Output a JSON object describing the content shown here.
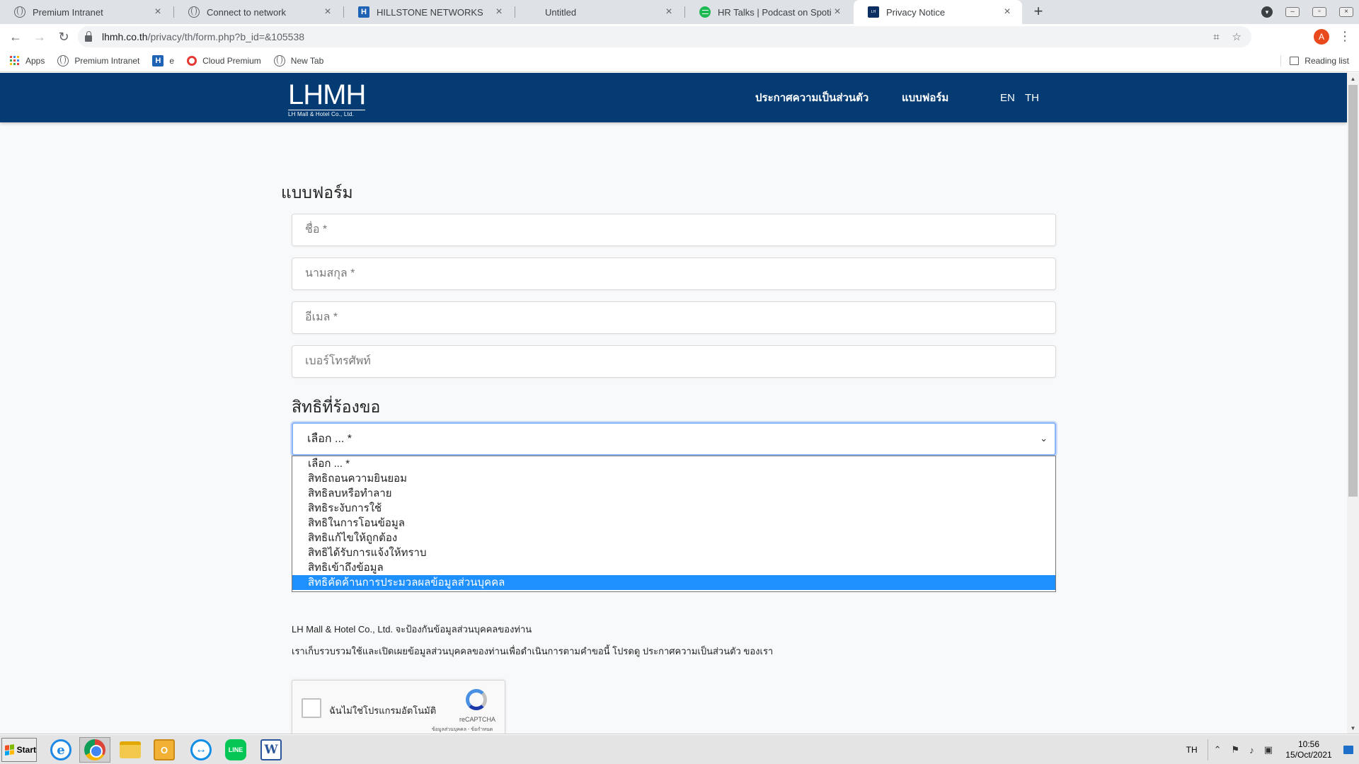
{
  "browser": {
    "tabs": [
      {
        "title": "Premium Intranet",
        "favicon": "globe-icon"
      },
      {
        "title": "Connect to network",
        "favicon": "globe-icon"
      },
      {
        "title": "HILLSTONE NETWORKS",
        "favicon": "hillstone-icon"
      },
      {
        "title": "Untitled",
        "favicon": "none"
      },
      {
        "title": "HR Talks | Podcast on Spotify",
        "favicon": "spotify-icon"
      },
      {
        "title": "Privacy Notice",
        "favicon": "lhmh-icon"
      }
    ],
    "active_tab": "Privacy Notice",
    "url_domain": "lhmh.co.th",
    "url_path": "/privacy/th/form.php?b_id=&105538",
    "profile_initial": "A",
    "bookmarks": [
      {
        "label": "Apps"
      },
      {
        "label": "Premium Intranet"
      },
      {
        "label": "e"
      },
      {
        "label": "Cloud Premium"
      },
      {
        "label": "New Tab"
      }
    ],
    "reading_list": "Reading list"
  },
  "site": {
    "logo_main": "LHMH",
    "logo_sub": "LH Mall & Hotel Co., Ltd.",
    "menu": [
      "ประกาศความเป็นส่วนตัว",
      "แบบฟอร์ม"
    ],
    "lang": [
      "EN",
      "TH"
    ],
    "brand_color": "#033b72"
  },
  "form": {
    "heading": "แบบฟอร์ม",
    "fields": [
      {
        "placeholder": "ชื่อ *"
      },
      {
        "placeholder": "นามสกุล *"
      },
      {
        "placeholder": "อีเมล *"
      },
      {
        "placeholder": "เบอร์โทรศัพท์"
      }
    ],
    "rights_heading": "สิทธิที่ร้องขอ",
    "select_value": "เลือก ... *",
    "options": [
      "เลือก ... *",
      "สิทธิถอนความยินยอม",
      "สิทธิลบหรือทำลาย",
      "สิทธิระงับการใช้",
      "สิทธิในการโอนข้อมูล",
      "สิทธิแก้ไขให้ถูกต้อง",
      "สิทธิได้รับการแจ้งให้ทราบ",
      "สิทธิเข้าถึงข้อมูล",
      "สิทธิคัดค้านการประมวลผลข้อมูลส่วนบุคคล"
    ],
    "highlighted_option": "สิทธิคัดค้านการประมวลผลข้อมูลส่วนบุคคล",
    "info_line1": "LH Mall & Hotel Co., Ltd. จะป้องกันข้อมูลส่วนบุคคลของท่าน",
    "info_line2": "เราเก็บรวบรวมใช้และเปิดเผยข้อมูลส่วนบุคคลของท่านเพื่อดำเนินการตามคำขอนี้ โปรดดู ประกาศความเป็นส่วนตัว ของเรา",
    "captcha_label": "ฉันไม่ใช่โปรแกรมอัตโนมัติ",
    "captcha_brand": "reCAPTCHA",
    "captcha_terms": "ข้อมูลส่วนบุคคล - ข้อกำหนด"
  },
  "taskbar": {
    "start_label": "Start",
    "apps": [
      "ie-icon",
      "chrome-icon",
      "explorer-icon",
      "outlook-icon",
      "teamviewer-icon",
      "line-icon",
      "word-icon"
    ],
    "line_label": "LINE",
    "word_label": "W",
    "ie_label": "e",
    "lang": "TH",
    "time": "10:56",
    "date": "15/Oct/2021"
  }
}
